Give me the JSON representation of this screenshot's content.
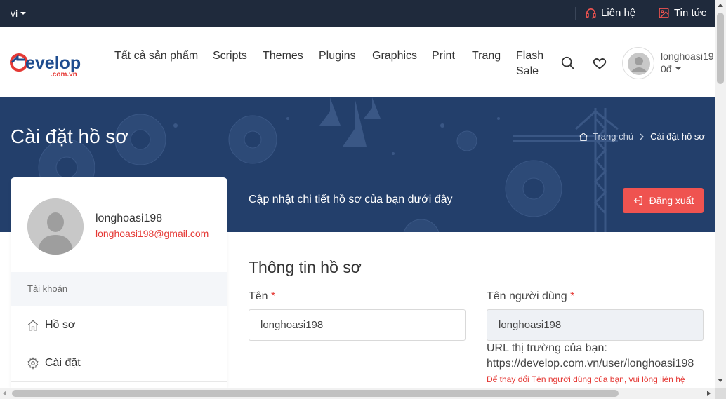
{
  "topbar": {
    "language": "vi",
    "contact_label": "Liên hệ",
    "news_label": "Tin tức"
  },
  "header": {
    "logo_text": "Develop",
    "logo_sub": ".com.vn",
    "nav": [
      {
        "label": "Tất cả sản phẩm"
      },
      {
        "label": "Scripts"
      },
      {
        "label": "Themes"
      },
      {
        "label": "Plugins"
      },
      {
        "label": "Graphics"
      },
      {
        "label": "Print"
      },
      {
        "label": "Trang"
      },
      {
        "label": "Flash Sale"
      }
    ],
    "username": "longhoasi19",
    "balance": "0đ"
  },
  "hero": {
    "title": "Cài đặt hồ sơ",
    "breadcrumb_home": "Trang chủ",
    "breadcrumb_current": "Cài đặt hồ sơ",
    "subtitle": "Cập nhật chi tiết hồ sơ của bạn dưới đây",
    "logout_label": "Đăng xuất"
  },
  "profile_card": {
    "name": "longhoasi198",
    "email": "longhoasi198@gmail.com",
    "section_label": "Tài khoản",
    "items": [
      {
        "label": "Hồ sơ",
        "icon": "home-icon"
      },
      {
        "label": "Cài đặt",
        "icon": "gear-icon"
      }
    ]
  },
  "form": {
    "title": "Thông tin hồ sơ",
    "name_label": "Tên",
    "name_value": "longhoasi198",
    "username_label": "Tên người dùng",
    "username_value": "longhoasi198",
    "required_mark": "*",
    "url_label": "URL thị trường của bạn:",
    "url_value": "https://develop.com.vn/user/longhoasi198",
    "note": "Để thay đổi Tên người dùng của bạn, vui lòng liên hệ"
  },
  "colors": {
    "topbar": "#1f2a3c",
    "hero": "#233f6b",
    "accent_red": "#ef5350"
  }
}
